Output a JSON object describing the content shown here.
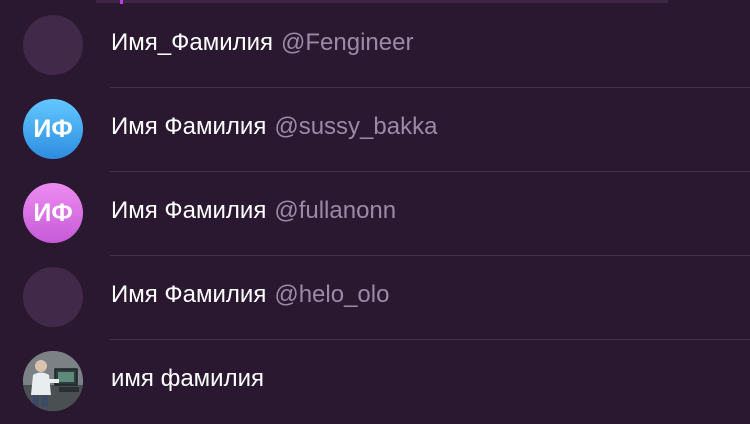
{
  "contacts": [
    {
      "name": "Имя_Фамилия",
      "handle": "@Fengineer",
      "initials": "",
      "avatar": "blank"
    },
    {
      "name": "Имя Фамилия",
      "handle": "@sussy_bakka",
      "initials": "ИФ",
      "avatar": "blue"
    },
    {
      "name": "Имя Фамилия",
      "handle": "@fullanonn",
      "initials": "ИФ",
      "avatar": "pink"
    },
    {
      "name": "Имя Фамилия",
      "handle": "@helo_olo",
      "initials": "",
      "avatar": "blank"
    },
    {
      "name": "имя фамилия",
      "handle": "",
      "initials": "",
      "avatar": "photo"
    }
  ],
  "colors": {
    "background": "#2a1730",
    "accent": "#b53ee6",
    "handle": "#9b8aa5"
  }
}
